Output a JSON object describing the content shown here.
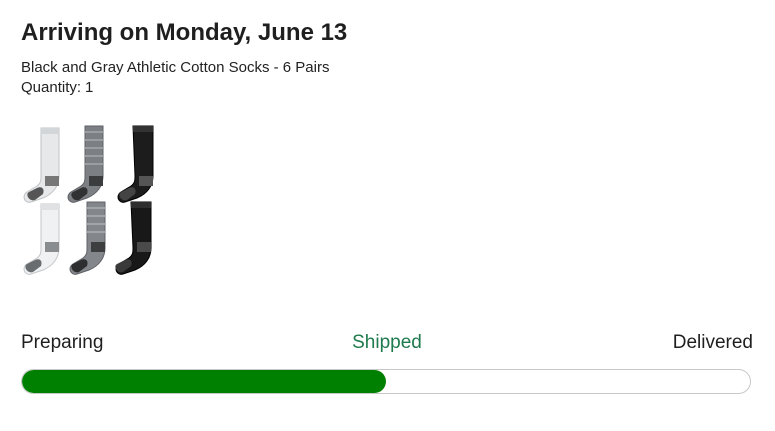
{
  "delivery": {
    "heading": "Arriving on Monday, June 13"
  },
  "product": {
    "name": "Black and Gray Athletic Cotton Socks - 6 Pairs",
    "quantity_label": "Quantity:",
    "quantity_value": "1",
    "image_icon": "sock-set-image"
  },
  "progress": {
    "steps": [
      "Preparing",
      "Shipped",
      "Delivered"
    ],
    "current_step": "Shipped",
    "fraction_complete": 0.5,
    "colors": {
      "fill": "#008000",
      "current_label": "#1f7a4d",
      "track_border": "#c8c8c8"
    }
  }
}
